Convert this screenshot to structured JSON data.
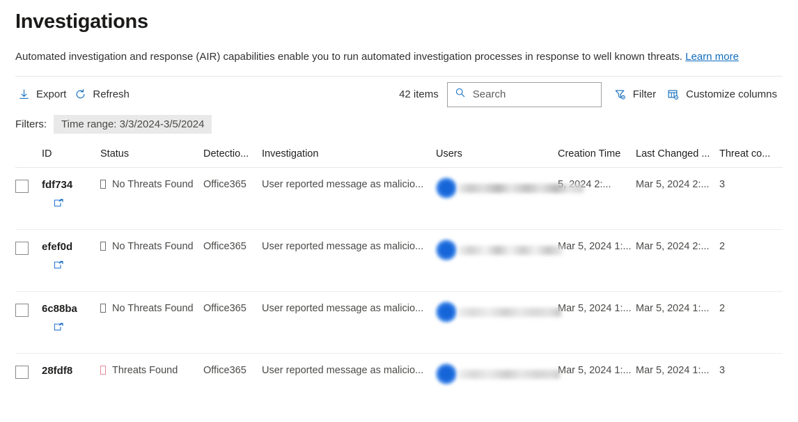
{
  "page": {
    "title": "Investigations",
    "description": "Automated investigation and response (AIR) capabilities enable you to run automated investigation processes in response to well known threats.",
    "learn_more": "Learn more"
  },
  "toolbar": {
    "export_label": "Export",
    "export_icon": "download-arrow-icon",
    "refresh_label": "Refresh",
    "refresh_icon": "refresh-icon",
    "items_count": "42 items",
    "search_placeholder": "Search",
    "search_value": "",
    "search_icon": "search-icon",
    "filter_label": "Filter",
    "filter_icon": "filter-gear-icon",
    "customize_columns_label": "Customize columns",
    "customize_columns_icon": "table-gear-icon"
  },
  "filters": {
    "label": "Filters:",
    "pills": [
      {
        "text": "Time range: 3/3/2024-3/5/2024"
      }
    ]
  },
  "table": {
    "columns": [
      {
        "key": "id",
        "label": "ID"
      },
      {
        "key": "status",
        "label": "Status"
      },
      {
        "key": "detection",
        "label": "Detectio..."
      },
      {
        "key": "investigation",
        "label": "Investigation"
      },
      {
        "key": "users",
        "label": "Users"
      },
      {
        "key": "creation_time",
        "label": "Creation Time"
      },
      {
        "key": "last_changed",
        "label": "Last Changed ..."
      },
      {
        "key": "threat_count",
        "label": "Threat co..."
      }
    ],
    "rows": [
      {
        "id": "fdf734",
        "open_icon": "open-in-new-window-icon",
        "status": "No Threats Found",
        "status_kind": "none",
        "detection": "Office365",
        "investigation": "User reported message as malicio...",
        "user_redacted": true,
        "creation_time": "5, 2024 2:...",
        "last_changed": "Mar 5, 2024 2:...",
        "threat_count": "3"
      },
      {
        "id": "efef0d",
        "open_icon": "open-in-new-window-icon",
        "status": "No Threats Found",
        "status_kind": "none",
        "detection": "Office365",
        "investigation": "User reported message as malicio...",
        "user_redacted": true,
        "creation_time": "Mar 5, 2024 1:...",
        "last_changed": "Mar 5, 2024 2:...",
        "threat_count": "2"
      },
      {
        "id": "6c88ba",
        "open_icon": "open-in-new-window-icon",
        "status": "No Threats Found",
        "status_kind": "none",
        "detection": "Office365",
        "investigation": "User reported message as malicio...",
        "user_redacted": true,
        "creation_time": "Mar 5, 2024 1:...",
        "last_changed": "Mar 5, 2024 1:...",
        "threat_count": "2"
      },
      {
        "id": "28fdf8",
        "open_icon": "open-in-new-window-icon",
        "status": "Threats Found",
        "status_kind": "threat",
        "detection": "Office365",
        "investigation": "User reported message as malicio...",
        "user_redacted": true,
        "creation_time": "Mar 5, 2024 1:...",
        "last_changed": "Mar 5, 2024 1:...",
        "threat_count": "3"
      }
    ]
  },
  "colors": {
    "accent": "#0f6cbd",
    "threat": "#e8899a",
    "pill_bg": "#e9e9e9"
  }
}
